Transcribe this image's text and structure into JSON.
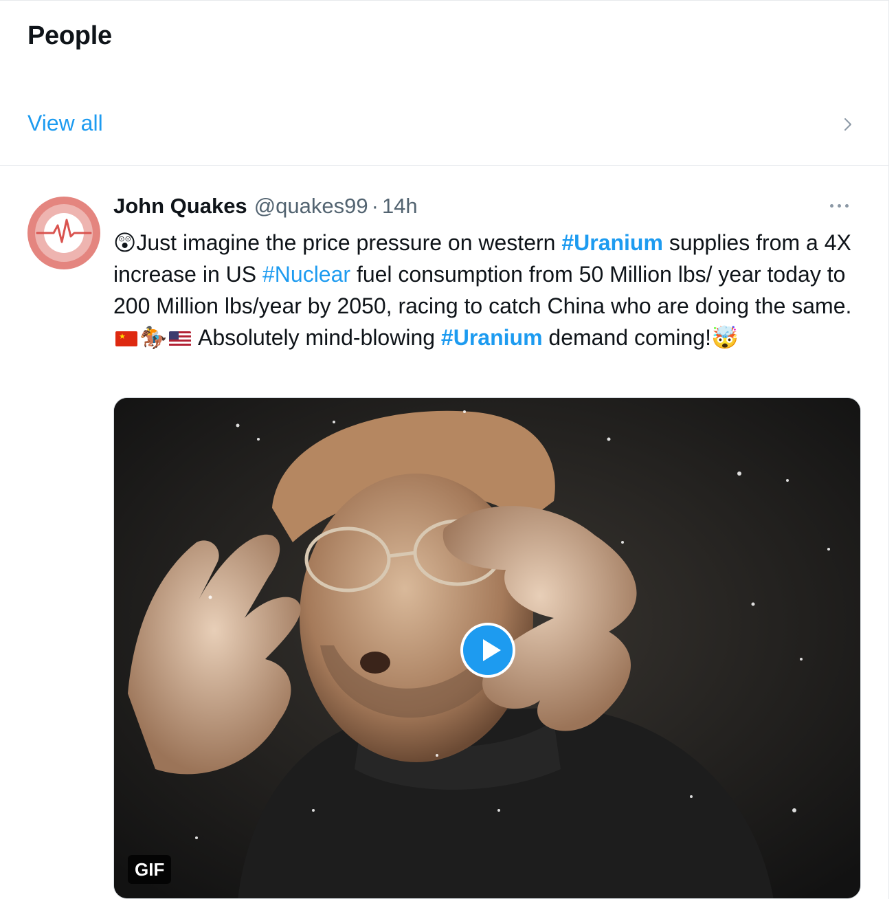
{
  "people": {
    "title": "People",
    "view_all": "View all"
  },
  "tweet": {
    "author_name": "John Quakes",
    "author_handle": "@quakes99",
    "separator": "·",
    "time": "14h",
    "text": {
      "emoji_start": "😲",
      "p1": "Just imagine the price pressure on western ",
      "tag1": "#Uranium",
      "p2": " supplies from a 4X increase in US ",
      "tag2": "#Nuclear",
      "p3": " fuel consumption from 50 Million lbs/ year today to 200 Million lbs/year by 2050, racing to catch China who are doing the same.",
      "emoji_horse": "🏇",
      "p4": " Absolutely mind-blowing ",
      "tag3": "#Uranium",
      "p5": " demand coming!",
      "emoji_end": "🤯"
    },
    "media": {
      "badge": "GIF",
      "type": "gif"
    }
  },
  "icons": {
    "chevron": "chevron-right-icon",
    "more": "more-horizontal-icon",
    "play": "play-icon",
    "avatar": "heartbeat-avatar"
  },
  "colors": {
    "link": "#1d9bf0",
    "text": "#0f1419",
    "muted": "#536471",
    "avatar": "#e4857f"
  }
}
